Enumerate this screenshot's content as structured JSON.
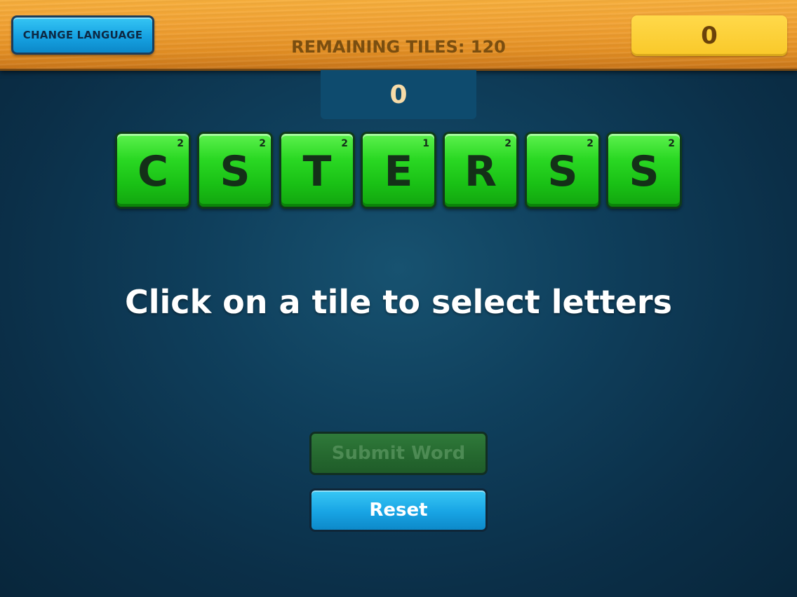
{
  "header": {
    "change_language_label": "CHANGE LANGUAGE",
    "remaining_tiles_label": "REMAINING TILES: 120",
    "total_score": "0"
  },
  "word_score": "0",
  "tiles": [
    {
      "letter": "C",
      "points": "2"
    },
    {
      "letter": "S",
      "points": "2"
    },
    {
      "letter": "T",
      "points": "2"
    },
    {
      "letter": "E",
      "points": "1"
    },
    {
      "letter": "R",
      "points": "2"
    },
    {
      "letter": "S",
      "points": "2"
    },
    {
      "letter": "S",
      "points": "2"
    }
  ],
  "instruction": "Click on a tile to select letters",
  "buttons": {
    "submit_label": "Submit Word",
    "reset_label": "Reset"
  },
  "colors": {
    "tile_green": "#2ad823",
    "button_blue": "#18a4e4",
    "score_yellow": "#f9c829",
    "background_navy": "#0f3f5c"
  }
}
